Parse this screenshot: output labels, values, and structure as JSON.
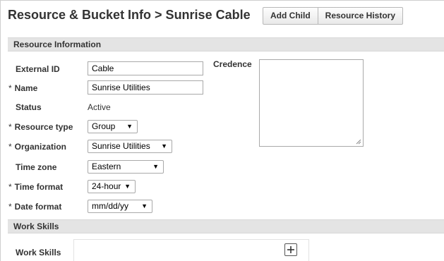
{
  "header": {
    "title": "Resource & Bucket Info > Sunrise Cable",
    "buttons": {
      "add_child": "Add Child",
      "resource_history": "Resource History"
    }
  },
  "sections": {
    "resource_information": "Resource Information",
    "work_skills": "Work Skills"
  },
  "form": {
    "required_marker": "*",
    "external_id": {
      "label": "External ID",
      "value": "Cable"
    },
    "name": {
      "label": "Name",
      "value": "Sunrise Utilities"
    },
    "status": {
      "label": "Status",
      "value": "Active"
    },
    "resource_type": {
      "label": "Resource type",
      "selected": "Group"
    },
    "organization": {
      "label": "Organization",
      "selected": "Sunrise Utilities"
    },
    "time_zone": {
      "label": "Time zone",
      "selected": "Eastern"
    },
    "time_format": {
      "label": "Time format",
      "selected": "24-hour"
    },
    "date_format": {
      "label": "Date format",
      "selected": "mm/dd/yy"
    },
    "credence": {
      "label": "Credence",
      "value": ""
    },
    "work_skills": {
      "label": "Work Skills"
    }
  },
  "icons": {
    "dropdown": "dropdown-arrow-icon",
    "resize": "resize-grip-icon",
    "add": "plus-icon"
  },
  "colors": {
    "section_bar": "#e4e4e4",
    "border": "#a9a9a9",
    "text": "#333333"
  }
}
